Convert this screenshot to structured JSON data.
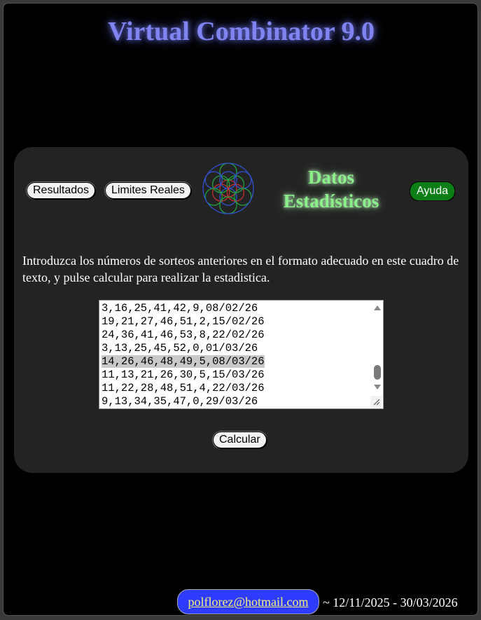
{
  "app": {
    "title": "Virtual Combinator 9.0"
  },
  "toolbar": {
    "results_label": "Resultados",
    "limits_label": "Limites Reales",
    "help_label": "Ayuda"
  },
  "section": {
    "title_line1": "Datos",
    "title_line2": "Estadísticos"
  },
  "instructions": "Introduzca los números de sorteos anteriores en el formato adecuado en este cuadro de texto, y pulse calcular para realizar la estadistica.",
  "draws_text": {
    "lines": [
      "3,16,25,41,42,9,08/02/26",
      "19,21,27,46,51,2,15/02/26",
      "24,36,41,46,53,8,22/02/26",
      "3,13,25,45,52,0,01/03/26",
      "14,26,46,48,49,5,08/03/26",
      "11,13,21,26,30,5,15/03/26",
      "11,22,28,48,51,4,22/03/26",
      "9,13,34,35,47,0,29/03/26"
    ],
    "selected_index": 4
  },
  "calculate_label": "Calcular",
  "footer": {
    "email": "polflorez@hotmail.com",
    "dates": "~ 12/11/2025 - 30/03/2026"
  },
  "colors": {
    "title": "#7f84f0",
    "section_title": "#8bf08a",
    "help_button": "#0b7f16",
    "email_badge": "#2e3cff",
    "email_text": "#f5f07c",
    "panel": "#232323"
  },
  "icons": {
    "logo": "flower-of-life-icon",
    "scroll_up": "arrow-up-icon",
    "scroll_down": "arrow-down-icon",
    "resize": "resize-grip-icon"
  }
}
